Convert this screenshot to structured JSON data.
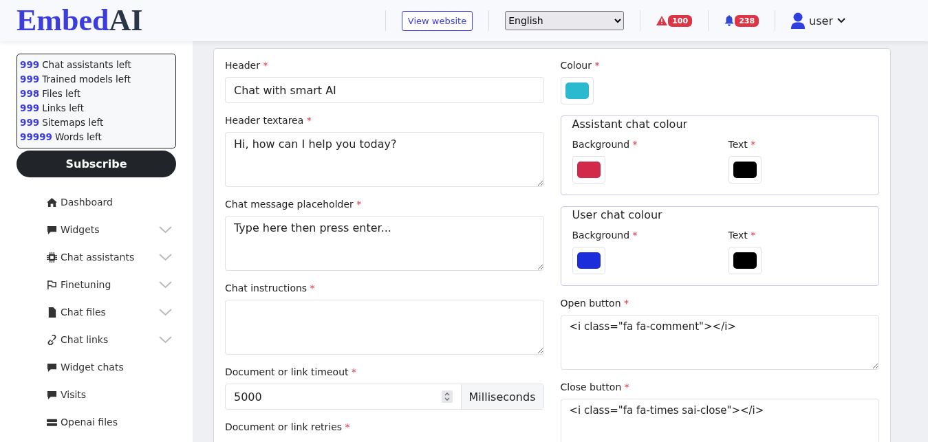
{
  "logo": {
    "primary": "Embed",
    "secondary": "AI"
  },
  "header": {
    "view_website": "View website",
    "language": "English",
    "alerts_badge": "100",
    "notifications_badge": "238",
    "user": "user"
  },
  "sidebar": {
    "stats": [
      {
        "count": "999",
        "label": "Chat assistants left"
      },
      {
        "count": "999",
        "label": "Trained models left"
      },
      {
        "count": "998",
        "label": "Files left"
      },
      {
        "count": "999",
        "label": "Links left"
      },
      {
        "count": "999",
        "label": "Sitemaps left"
      },
      {
        "count": "99999",
        "label": "Words left"
      }
    ],
    "subscribe": "Subscribe",
    "items": [
      {
        "label": "Dashboard",
        "expandable": false
      },
      {
        "label": "Widgets",
        "expandable": true
      },
      {
        "label": "Chat assistants",
        "expandable": true
      },
      {
        "label": "Finetuning",
        "expandable": true
      },
      {
        "label": "Chat files",
        "expandable": true
      },
      {
        "label": "Chat links",
        "expandable": true
      },
      {
        "label": "Widget chats",
        "expandable": false
      },
      {
        "label": "Visits",
        "expandable": false
      },
      {
        "label": "Openai files",
        "expandable": false
      }
    ]
  },
  "form": {
    "left": [
      {
        "kind": "input",
        "label": "Header",
        "required_mark": "*",
        "value": "Chat with smart AI"
      },
      {
        "kind": "textarea",
        "label": "Header textarea",
        "required_mark": "*",
        "value": "Hi, how can I help you today?"
      },
      {
        "kind": "textarea",
        "label": "Chat message placeholder",
        "required_mark": "*",
        "value": "Type here then press enter..."
      },
      {
        "kind": "textarea",
        "label": "Chat instructions",
        "required_mark": "*"
      },
      {
        "kind": "number",
        "label": "Document or link timeout",
        "required_mark": "*",
        "value": "5000",
        "unit": "Milliseconds"
      },
      {
        "kind": "label",
        "label": "Document or link retries",
        "required_mark": "*"
      }
    ],
    "colour": {
      "label": "Colour",
      "required_mark": "*",
      "color": "#2ab9cf"
    },
    "groups": [
      {
        "legend": "Assistant chat colour",
        "pickers": [
          {
            "label": "Background",
            "required_mark": "*",
            "color": "#d2284a"
          },
          {
            "label": "Text",
            "required_mark": "*",
            "color": "#000000"
          }
        ]
      },
      {
        "legend": "User chat colour",
        "pickers": [
          {
            "label": "Background",
            "required_mark": "*",
            "color": "#1c2ddc"
          },
          {
            "label": "Text",
            "required_mark": "*",
            "color": "#000000"
          }
        ]
      }
    ],
    "right": [
      {
        "kind": "textarea",
        "label": "Open button",
        "required_mark": "*",
        "value": "<i class=\"fa fa-comment\"></i>"
      },
      {
        "kind": "textarea",
        "label": "Close button",
        "required_mark": "*",
        "value": "<i class=\"fa fa-times sai-close\"></i>"
      }
    ]
  }
}
